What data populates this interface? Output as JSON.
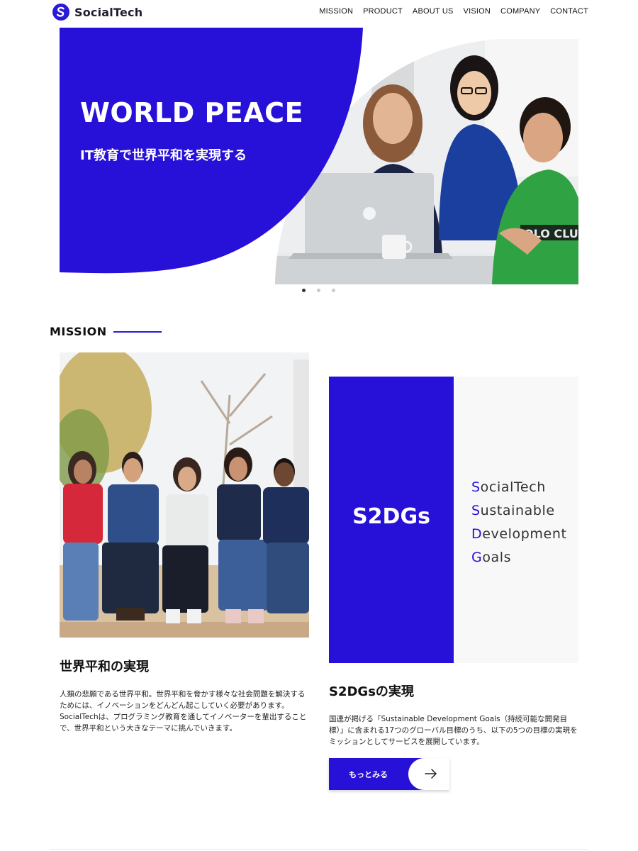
{
  "brand": {
    "name": "SocialTech",
    "logo_letter": "S",
    "accent": "#2710d8"
  },
  "nav": {
    "items": [
      "MISSION",
      "PRODUCT",
      "ABOUT US",
      "VISION",
      "COMPANY",
      "CONTACT"
    ]
  },
  "hero": {
    "title": "WORLD PEACE",
    "subtitle": "IT教育で世界平和を実現する",
    "slides_total": 3,
    "active_slide": 1
  },
  "mission": {
    "section_title": "MISSION",
    "left": {
      "heading": "世界平和の実現",
      "body": "人類の悲願である世界平和。世界平和を脅かす様々な社会問題を解決するためには、イノベーションをどんどん起こしていく必要があります。SocialTechは、プログラミング教育を通してイノベーターを輩出することで、世界平和という大きなテーマに挑んでいきます。"
    },
    "right": {
      "card_logo": "S2DGs",
      "card_lines": [
        {
          "cap": "S",
          "rest": "ocialTech"
        },
        {
          "cap": "S",
          "rest": "ustainable"
        },
        {
          "cap": "D",
          "rest": "evelopment"
        },
        {
          "cap": "G",
          "rest": "oals"
        }
      ],
      "heading": "S2DGsの実現",
      "body": "国連が掲げる「Sustainable Development Goals（持続可能な開発目標）」に含まれる17つのグローバル目標のうち、以下の5つの目標の実現をミッションとしてサービスを展開しています。",
      "button_label": "もっとみる"
    }
  }
}
